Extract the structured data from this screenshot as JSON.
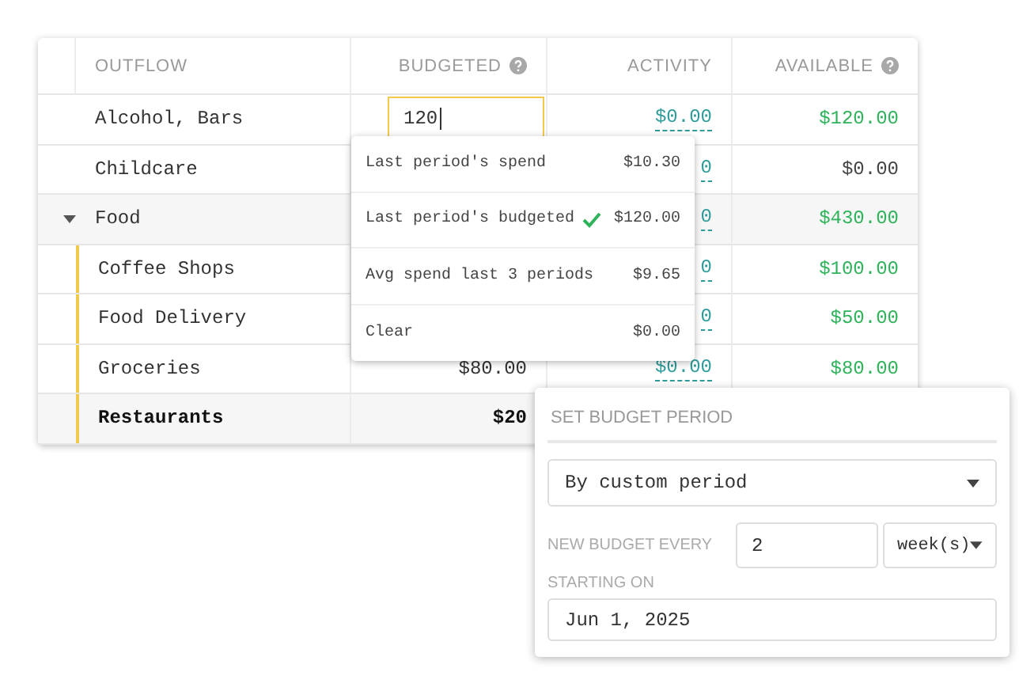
{
  "table": {
    "columns": [
      {
        "label": "OUTFLOW",
        "help": false
      },
      {
        "label": "BUDGETED",
        "help": true
      },
      {
        "label": "ACTIVITY",
        "help": false
      },
      {
        "label": "AVAILABLE",
        "help": true
      }
    ],
    "rows": [
      {
        "name": "Alcohol, Bars",
        "selected": false,
        "budget_input": "120",
        "activity": "$0.00",
        "available": "$120.00",
        "color": "#2fb35a"
      },
      {
        "name": "Childcare",
        "selected": false,
        "activity": "0",
        "available": "$0.00",
        "color": "#444444"
      },
      {
        "name": "Food",
        "expanded": true,
        "selected": false,
        "activity": "0",
        "available": "$430.00",
        "color": "#2fb35a",
        "children": [
          {
            "name": "Coffee Shops",
            "selected": false,
            "activity": "0",
            "available": "$100.00",
            "color": "#2fb35a"
          },
          {
            "name": "Food Delivery",
            "selected": false,
            "activity": "0",
            "available": "$50.00",
            "color": "#2fb35a"
          },
          {
            "name": "Groceries",
            "selected": false,
            "budgeted": "$80.00",
            "activity": "$0.00",
            "available": "$80.00",
            "color": "#2fb35a"
          },
          {
            "name": "Restaurants",
            "selected": true,
            "budgeted": "$20"
          }
        ]
      }
    ]
  },
  "budget_menu": {
    "items": [
      {
        "label": "Last period's spend",
        "amount": "$10.30",
        "checked": false
      },
      {
        "label": "Last period's budgeted",
        "amount": "$120.00",
        "checked": true
      },
      {
        "label": "Avg spend last 3 periods",
        "amount": "$9.65",
        "checked": false
      },
      {
        "label": "Clear",
        "amount": "$0.00",
        "checked": false
      }
    ]
  },
  "period_panel": {
    "title": "SET BUDGET PERIOD",
    "period_select": "By custom period",
    "every_label": "NEW BUDGET EVERY",
    "every_value": "2",
    "unit_select": "week(s)",
    "start_label": "STARTING ON",
    "start_date": "Jun 1, 2025"
  }
}
